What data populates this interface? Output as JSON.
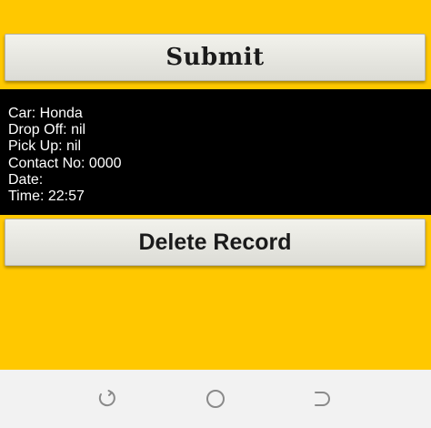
{
  "buttons": {
    "submit_label": "Submit",
    "delete_label": "Delete Record"
  },
  "record": {
    "car": "Car: Honda",
    "drop_off": "Drop Off: nil",
    "pick_up": "Pick Up: nil",
    "contact": "Contact No: 0000",
    "date": "Date:",
    "time": "Time: 22:57"
  },
  "navigation": {
    "icons": [
      "back-icon",
      "home-icon",
      "recent-apps-icon"
    ]
  },
  "colors": {
    "background": "#ffc800",
    "panel": "#000000",
    "panel_text": "#ffffff",
    "button_face": "#e8e8e2",
    "navbar": "#f2f2f2"
  }
}
